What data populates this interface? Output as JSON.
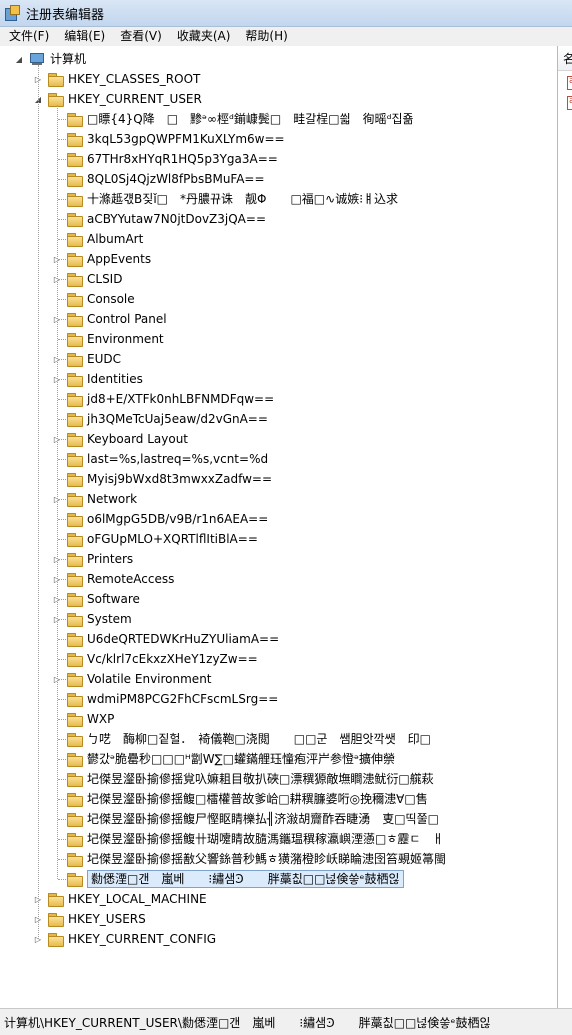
{
  "window": {
    "title": "注册表编辑器"
  },
  "menu": [
    {
      "label": "文件(F)"
    },
    {
      "label": "编辑(E)"
    },
    {
      "label": "查看(V)"
    },
    {
      "label": "收藏夹(A)"
    },
    {
      "label": "帮助(H)"
    }
  ],
  "right_pane": {
    "header_label": "名"
  },
  "tree": {
    "root": {
      "label": "计算机",
      "expanded": true
    },
    "hives_top": [
      {
        "label": "HKEY_CLASSES_ROOT",
        "expanded": false
      },
      {
        "label": "HKEY_CURRENT_USER",
        "expanded": true
      }
    ],
    "hkcu_children": [
      {
        "label": "□瞟{4}Q降　□　黪ᵊ∞桱ᵈ鎆嵻鬓□　畦갈桯□씗　徇暚ᵈ집죪",
        "expandable": false
      },
      {
        "label": "3kqL53gpQWPFM1KuXLYm6w==",
        "expandable": false
      },
      {
        "label": "67THr8xHYqR1HQ5p3Yga3A==",
        "expandable": false
      },
      {
        "label": "8QL0Sj4QjzWl8fPbsBMuFA==",
        "expandable": false
      },
      {
        "label": "十滌趆걗B짖ǐ□　*丹膿뀨诛　靓Φ　　□福□∿诚嫉⁝ㅒ込求",
        "expandable": false
      },
      {
        "label": "aCBYYutaw7N0jtDovZ3jQA==",
        "expandable": false
      },
      {
        "label": "AlbumArt",
        "expandable": false
      },
      {
        "label": "AppEvents",
        "expandable": true
      },
      {
        "label": "CLSID",
        "expandable": true
      },
      {
        "label": "Console",
        "expandable": false
      },
      {
        "label": "Control Panel",
        "expandable": true
      },
      {
        "label": "Environment",
        "expandable": false
      },
      {
        "label": "EUDC",
        "expandable": true
      },
      {
        "label": "Identities",
        "expandable": true
      },
      {
        "label": "jd8+E/XTFk0nhLBFNMDFqw==",
        "expandable": false
      },
      {
        "label": "jh3QMeTcUaj5eaw/d2vGnA==",
        "expandable": false
      },
      {
        "label": "Keyboard Layout",
        "expandable": true
      },
      {
        "label": "last=%s,lastreq=%s,vcnt=%d",
        "expandable": false
      },
      {
        "label": "Myisj9bWxd8t3mwxxZadfw==",
        "expandable": false
      },
      {
        "label": "Network",
        "expandable": true
      },
      {
        "label": "o6lMgpG5DB/v9B/r1n6AEA==",
        "expandable": false
      },
      {
        "label": "oFGUpMLO+XQRTlflItiBlA==",
        "expandable": false
      },
      {
        "label": "Printers",
        "expandable": true
      },
      {
        "label": "RemoteAccess",
        "expandable": true
      },
      {
        "label": "Software",
        "expandable": true
      },
      {
        "label": "System",
        "expandable": true
      },
      {
        "label": "U6deQRTEDWKrHuZYUliamA==",
        "expandable": false
      },
      {
        "label": "Vc/klrl7cEkxzXHeY1zyZw==",
        "expandable": false
      },
      {
        "label": "Volatile Environment",
        "expandable": true
      },
      {
        "label": "wdmiPM8PCG2FhCFscmLSrg==",
        "expandable": false
      },
      {
        "label": "WXP",
        "expandable": false
      },
      {
        "label": "ㄅ呓　酶柳□짙헐．　裿儀鞄□浇閲　　□□군　쌤胆앗깍쌧　印□",
        "expandable": false
      },
      {
        "label": "鬰갔ᵊ脆罍秒□□□ᴴ劏W∑□蠸鏋艃珏憧疱泙屵参憕ᵊ擴伸禜",
        "expandable": false
      },
      {
        "label": "圮傑昱瀣卧揄傪揺覍叺嫲耝目敬扒硤□漂穓獂敵墲瞷漶鱿衍□艞萩",
        "expandable": false
      },
      {
        "label": "圮傑昱瀣卧揄傪揺鳆□檑權普故爹峆□耕穓臁婆哘◎挽穪漶∀□售",
        "expandable": false
      },
      {
        "label": "圮傑昱瀣卧揄傪揺鳆尸慳眍睛櫟払╢济潊胡齎酢吞睫湧　叓□띡쭐□",
        "expandable": false
      },
      {
        "label": "圮傑昱瀣卧揄傪揺鳆卄瑚嚔睛故膸溤鑴瑥穓稼瀛嶼湮懣□ㅎ靂ㄷ　ㅐ",
        "expandable": false
      },
      {
        "label": "圮傑昱瀣卧揄傪揺敾父響銯普秒鰢ㅎ獚潴橙眕岆睇睔漶囹笞覡姬箒閩",
        "expandable": false
      },
      {
        "label": "勬僁湮□갠　嵐베　　⁝繡샘Ͽ　　胖藁칪□□넎倹씋ᵉ鼓栖읺",
        "expandable": false,
        "selected": true
      }
    ],
    "hives_bottom": [
      {
        "label": "HKEY_LOCAL_MACHINE",
        "expanded": false
      },
      {
        "label": "HKEY_USERS",
        "expanded": false
      },
      {
        "label": "HKEY_CURRENT_CONFIG",
        "expanded": false
      }
    ]
  },
  "status_bar": {
    "path": "计算机\\HKEY_CURRENT_USER\\勬僁湮□갠　嵐베　　⁝繡샘Ͽ　　胖藁칪□□넎倹씋ᵉ鼓栖읺"
  },
  "icons": {
    "folder": "folder-icon",
    "computer": "computer-icon",
    "expand": "expand-arrow-icon",
    "collapse": "collapse-arrow-icon"
  }
}
